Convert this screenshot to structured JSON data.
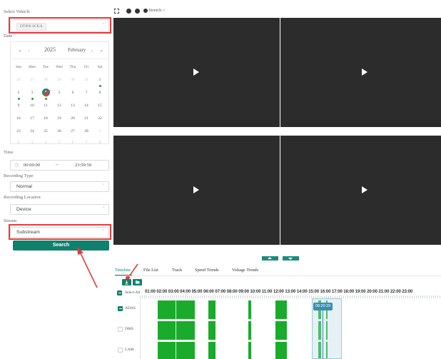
{
  "left_panel": {
    "vehicle": {
      "label": "Select Vehicle",
      "tag": "DT800 SCKA"
    },
    "date": {
      "label": "Date",
      "nav_prev_year": "«",
      "nav_prev_month": "‹",
      "year": "2025",
      "month": "February",
      "nav_next_month": "›",
      "nav_next_year": "»",
      "weekdays": [
        "Sun",
        "Mon",
        "Tue",
        "Wed",
        "Thu",
        "Fri",
        "Sat"
      ],
      "weeks": [
        [
          "26",
          "27",
          "28",
          "29",
          "30",
          "31",
          "1"
        ],
        [
          "2",
          "3",
          "4",
          "5",
          "6",
          "7",
          "8"
        ],
        [
          "9",
          "10",
          "11",
          "12",
          "13",
          "14",
          "15"
        ],
        [
          "16",
          "17",
          "18",
          "19",
          "20",
          "21",
          "22"
        ],
        [
          "23",
          "24",
          "25",
          "26",
          "27",
          "28",
          "1"
        ],
        [
          "2",
          "3",
          "4",
          "5",
          "6",
          "7",
          "8"
        ]
      ],
      "selected_day": "4",
      "days_with_recordings": [
        "1",
        "2",
        "3",
        "4"
      ]
    },
    "time": {
      "label": "Time",
      "start": "00:00:00",
      "separator": "~",
      "end": "23:59:59"
    },
    "recording_type": {
      "label": "Recording Type",
      "value": "Normal"
    },
    "recording_location": {
      "label": "Recording Location",
      "value": "Device"
    },
    "stream": {
      "label": "Stream",
      "value": "Substream"
    },
    "search_label": "Search"
  },
  "toolbar": {
    "stretch_label": "Stretch ˅"
  },
  "tabs": [
    "Timeline",
    "File List",
    "Track",
    "Speed Trends",
    "Voltage Trends"
  ],
  "active_tab": "Timeline",
  "timeline": {
    "select_all_label": "Select All",
    "hours": [
      "01:00",
      "02:00",
      "03:00",
      "04:00",
      "05:00",
      "06:00",
      "07:00",
      "08:00",
      "09:00",
      "10:00",
      "11:00",
      "12:00",
      "13:00",
      "14:00",
      "15:00",
      "16:00",
      "17:00",
      "18:00",
      "19:00",
      "20:00",
      "21:00",
      "22:00",
      "23:00"
    ],
    "rows": [
      {
        "label": "ADAS",
        "checked": true
      },
      {
        "label": "DMS",
        "checked": false
      },
      {
        "label": "CAM",
        "checked": false
      }
    ],
    "cursor_time": "08:20:29"
  },
  "colors": {
    "accent": "#11806d",
    "highlight": "#e53b3b",
    "recording": "#1bab2c",
    "video_bg": "#2c2c2c"
  }
}
